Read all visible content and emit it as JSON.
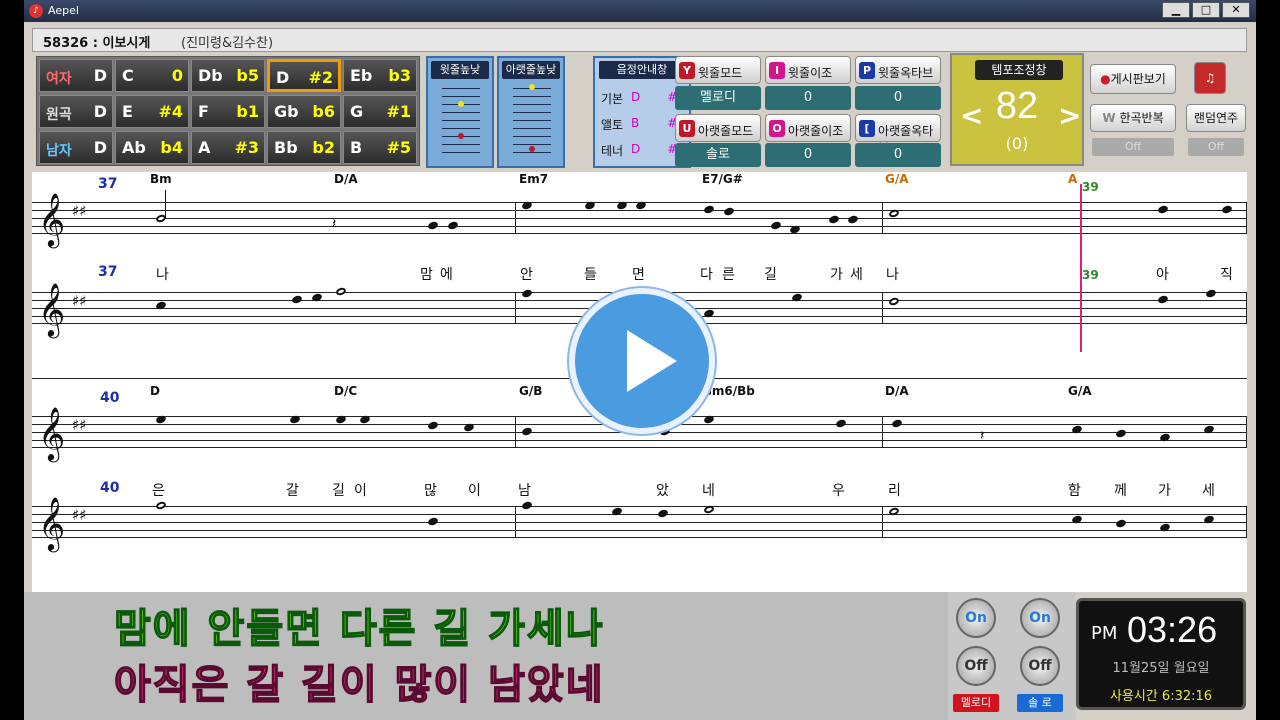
{
  "window": {
    "app_title": "Aepel",
    "minimize": "▁",
    "maximize": "□",
    "close": "✕"
  },
  "song": {
    "number_title": "58326 : 이보시게",
    "artist": "(진미령&김수찬)"
  },
  "key_table": {
    "rows": [
      {
        "label": "여자",
        "label_key": "D",
        "cells": [
          {
            "k": "C",
            "v": "0"
          },
          {
            "k": "Db",
            "v": "b5"
          },
          {
            "k": "D",
            "v": "#2"
          },
          {
            "k": "Eb",
            "v": "b3"
          }
        ]
      },
      {
        "label": "원곡",
        "label_key": "D",
        "cells": [
          {
            "k": "E",
            "v": "#4"
          },
          {
            "k": "F",
            "v": "b1"
          },
          {
            "k": "Gb",
            "v": "b6"
          },
          {
            "k": "G",
            "v": "#1"
          }
        ]
      },
      {
        "label": "남자",
        "label_key": "D",
        "cells": [
          {
            "k": "Ab",
            "v": "b4"
          },
          {
            "k": "A",
            "v": "#3"
          },
          {
            "k": "Bb",
            "v": "b2"
          },
          {
            "k": "B",
            "v": "#5"
          }
        ]
      }
    ],
    "selected": "D"
  },
  "pitch_panels": {
    "upper": "윗줄높낮",
    "lower": "아랫줄높낮"
  },
  "guide": {
    "title": "음정안내창",
    "rows": [
      {
        "part": "기본",
        "note": "D",
        "value": "#2"
      },
      {
        "part": "앨토",
        "note": "B",
        "value": "#5"
      },
      {
        "part": "테너",
        "note": "D",
        "value": "#4"
      }
    ]
  },
  "modes": {
    "upper_mode": {
      "icon": "Y",
      "label": "윗줄모드",
      "value": "멜로디",
      "color": "#c0182a"
    },
    "upper_transpose": {
      "icon": "I",
      "label": "윗줄이조",
      "value": "0",
      "color": "#d4148c"
    },
    "upper_octave": {
      "icon": "P",
      "label": "윗줄옥타브",
      "value": "0",
      "color": "#1a3aa8"
    },
    "lower_mode": {
      "icon": "U",
      "label": "아랫줄모드",
      "value": "솔로",
      "color": "#c0182a"
    },
    "lower_transpose": {
      "icon": "O",
      "label": "아랫줄이조",
      "value": "0",
      "color": "#d4148c"
    },
    "lower_octave": {
      "icon": "[",
      "label": "아랫줄옥타브",
      "value": "0",
      "color": "#1a3aa8"
    }
  },
  "tempo": {
    "title": "템포조정창",
    "value": "82",
    "offset": "(0)",
    "left": "<",
    "right": ">"
  },
  "side_buttons": {
    "board": "게시판보기",
    "repeat": "한곡반복",
    "repeat_state": "Off",
    "random": "랜덤연주",
    "random_state": "Off"
  },
  "score": {
    "system1": {
      "measure_top": "37",
      "measure_bottom": "37",
      "measure_next": "39",
      "chords": [
        "Bm",
        "D/A",
        "Em7",
        "E7/G#",
        "G/A",
        "A"
      ],
      "lyrics": [
        "나",
        "맘",
        "에",
        "안",
        "들",
        "면",
        "다",
        "른",
        "길",
        "가",
        "세",
        "나",
        "아",
        "직"
      ]
    },
    "system2": {
      "measure_top": "40",
      "measure_bottom": "40",
      "chords": [
        "D",
        "D/C",
        "G/B",
        "Gm6/Bb",
        "D/A",
        "G/A"
      ],
      "lyrics": [
        "은",
        "갈",
        "길",
        "이",
        "많",
        "이",
        "남",
        "았",
        "네",
        "우",
        "리",
        "함",
        "께",
        "가",
        "세"
      ]
    }
  },
  "karaoke": {
    "line1": "맘에 안들면 다른 길 가세나",
    "line2": "아직은 갈 길이 많이 남았네"
  },
  "toggles": {
    "on": "On",
    "off": "Off",
    "melody_tag": "멜로디",
    "solo_tag": "솔 로"
  },
  "clock": {
    "ampm": "PM",
    "time": "03:26",
    "date": "11월25일 월요일",
    "usage": "사용시간 6:32:16"
  }
}
